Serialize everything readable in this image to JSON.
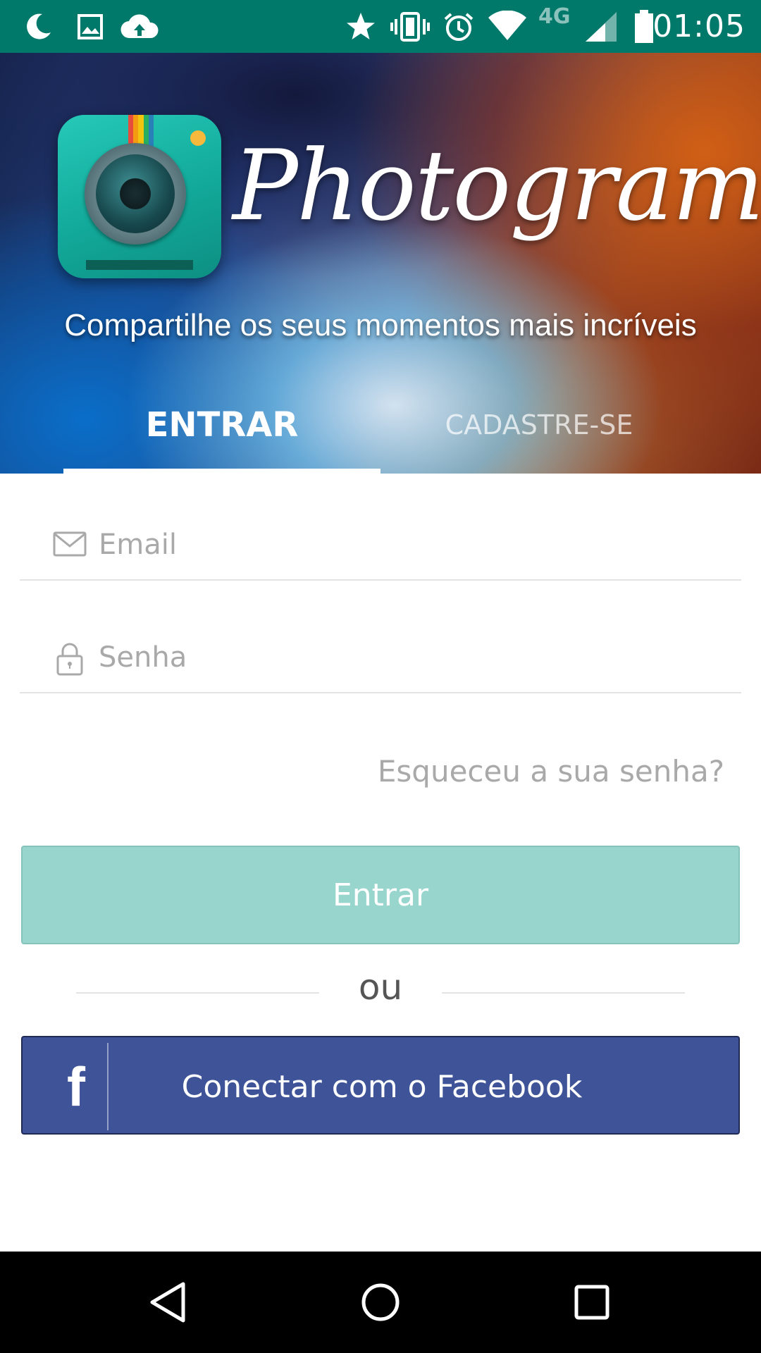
{
  "status_bar": {
    "time": "01:05",
    "network_label": "4G",
    "left_icons": [
      "moon-icon",
      "image-icon",
      "cloud-upload-icon"
    ],
    "right_icons": [
      "star-icon",
      "vibrate-icon",
      "alarm-icon",
      "wifi-icon",
      "signal-icon",
      "battery-icon"
    ]
  },
  "header": {
    "app_name": "Photogram",
    "tagline": "Compartilhe os seus momentos mais incríveis",
    "tabs": [
      {
        "label": "ENTRAR",
        "active": true
      },
      {
        "label": "CADASTRE-SE",
        "active": false
      }
    ]
  },
  "form": {
    "email_placeholder": "Email",
    "email_value": "",
    "password_placeholder": "Senha",
    "password_value": "",
    "forgot_password": "Esqueceu a sua senha?",
    "submit_label": "Entrar",
    "divider_text": "ou",
    "facebook_label": "Conectar com o Facebook"
  },
  "colors": {
    "status_bar": "#00796b",
    "submit_button": "#98d6cd",
    "facebook_button": "#3f5498",
    "nav_bar": "#000000"
  },
  "nav_bar": {
    "icons": [
      "back-icon",
      "home-icon",
      "recents-icon"
    ]
  }
}
